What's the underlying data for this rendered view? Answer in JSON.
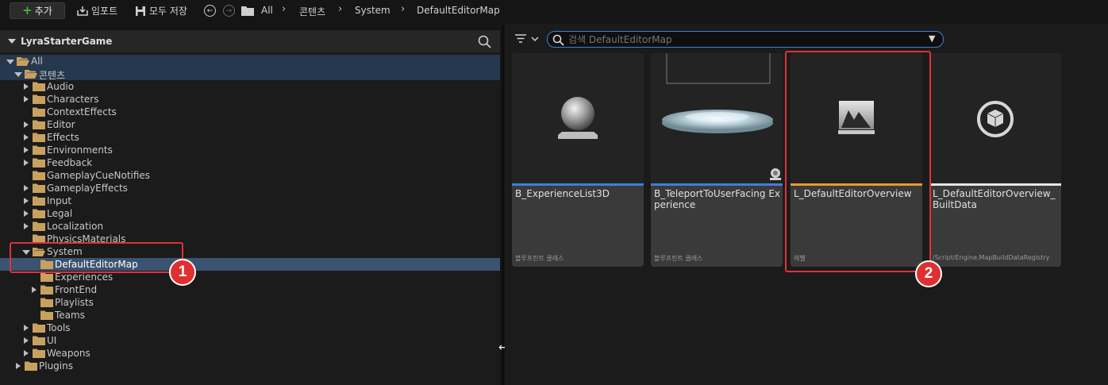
{
  "toolbar": {
    "add_label": "추가",
    "import_label": "임포트",
    "save_all_label": "모두 저장",
    "breadcrumb": [
      "All",
      "콘텐츠",
      "System",
      "DefaultEditorMap"
    ]
  },
  "sources_panel": {
    "title": "LyraStarterGame",
    "tree": [
      {
        "label": "All",
        "depth": 0,
        "state": "expanded"
      },
      {
        "label": "콘텐츠",
        "depth": 1,
        "state": "expanded"
      },
      {
        "label": "Audio",
        "depth": 2,
        "state": "collapsed"
      },
      {
        "label": "Characters",
        "depth": 2,
        "state": "collapsed"
      },
      {
        "label": "ContextEffects",
        "depth": 2,
        "state": "leaf"
      },
      {
        "label": "Editor",
        "depth": 2,
        "state": "collapsed"
      },
      {
        "label": "Effects",
        "depth": 2,
        "state": "collapsed"
      },
      {
        "label": "Environments",
        "depth": 2,
        "state": "collapsed"
      },
      {
        "label": "Feedback",
        "depth": 2,
        "state": "collapsed"
      },
      {
        "label": "GameplayCueNotifies",
        "depth": 2,
        "state": "leaf"
      },
      {
        "label": "GameplayEffects",
        "depth": 2,
        "state": "collapsed"
      },
      {
        "label": "Input",
        "depth": 2,
        "state": "collapsed"
      },
      {
        "label": "Legal",
        "depth": 2,
        "state": "collapsed"
      },
      {
        "label": "Localization",
        "depth": 2,
        "state": "collapsed"
      },
      {
        "label": "PhysicsMaterials",
        "depth": 2,
        "state": "leaf"
      },
      {
        "label": "System",
        "depth": 2,
        "state": "expanded"
      },
      {
        "label": "DefaultEditorMap",
        "depth": 3,
        "state": "leaf",
        "selected": true
      },
      {
        "label": "Experiences",
        "depth": 3,
        "state": "leaf"
      },
      {
        "label": "FrontEnd",
        "depth": 3,
        "state": "collapsed"
      },
      {
        "label": "Playlists",
        "depth": 3,
        "state": "leaf"
      },
      {
        "label": "Teams",
        "depth": 3,
        "state": "leaf"
      },
      {
        "label": "Tools",
        "depth": 2,
        "state": "collapsed"
      },
      {
        "label": "UI",
        "depth": 2,
        "state": "collapsed"
      },
      {
        "label": "Weapons",
        "depth": 2,
        "state": "collapsed"
      },
      {
        "label": "Plugins",
        "depth": 1,
        "state": "collapsed"
      }
    ]
  },
  "search": {
    "placeholder": "검색 DefaultEditorMap"
  },
  "assets": [
    {
      "name": "B_ExperienceList3D",
      "type": "블루프린트 클래스",
      "bar_color": "#3d7de0",
      "icon": "blueprint-sphere-icon"
    },
    {
      "name": "B_TeleportToUserFacing Experience",
      "type": "블루프린트 클래스",
      "bar_color": "#3d7de0",
      "icon": "teleport-pad-thumbnail"
    },
    {
      "name": "L_DefaultEditorOverview",
      "type": "레벨",
      "bar_color": "#e89a2c",
      "icon": "level-icon"
    },
    {
      "name": "L_DefaultEditorOverview_ BuiltData",
      "type": "/Script/Engine.MapBuildDataRegistry",
      "bar_color": "#e6e6e6",
      "icon": "data-cube-icon"
    }
  ],
  "annotations": {
    "badge_1": "1",
    "badge_2": "2"
  }
}
